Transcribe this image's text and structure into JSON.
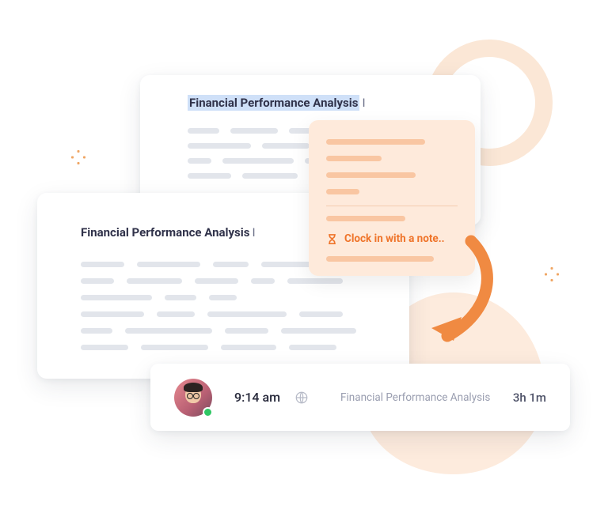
{
  "document_a": {
    "title": "Financial Performance Analysis"
  },
  "document_b": {
    "title": "Financial Performance Analysis"
  },
  "popup_menu": {
    "clock_in_label": "Clock in with a note.."
  },
  "timesheet_entry": {
    "start_time": "9:14 am",
    "note": "Financial Performance Analysis",
    "duration": "3h 1m",
    "status": "online"
  },
  "colors": {
    "accent": "#ef742a",
    "accent_light": "#feeadb"
  }
}
